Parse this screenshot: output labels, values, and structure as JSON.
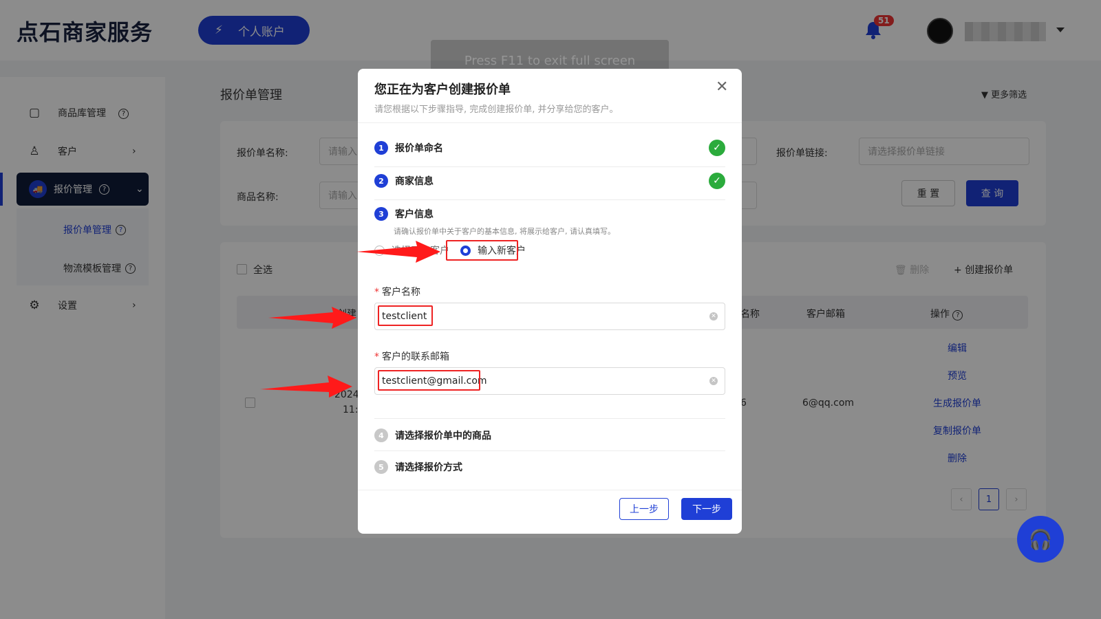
{
  "header": {
    "logo": "点石商家服务",
    "account_button": "个人账户",
    "notification_count": "51"
  },
  "sidebar": {
    "items": [
      {
        "label": "商品库管理",
        "icon": "box-icon"
      },
      {
        "label": "客户",
        "icon": "user-icon"
      },
      {
        "label": "报价管理",
        "icon": "truck-icon"
      },
      {
        "label": "设置",
        "icon": "gear-icon"
      }
    ],
    "sub_items": [
      {
        "label": "报价单管理"
      },
      {
        "label": "物流模板管理"
      }
    ]
  },
  "main": {
    "title": "报价单管理",
    "more_filters": "更多筛选",
    "filters": {
      "quote_name_label": "报价单名称:",
      "quote_name_placeholder": "请输入",
      "product_name_label": "商品名称:",
      "product_name_placeholder": "请输入",
      "quote_link_label": "报价单链接:",
      "quote_link_placeholder": "请选择报价单链接",
      "reset": "重 置",
      "query": "查 询"
    },
    "list": {
      "select_all": "全选",
      "delete": "删除",
      "create": "创建报价单",
      "columns": [
        "创建",
        "名称",
        "客户邮箱",
        "操作"
      ],
      "row": {
        "date": "2024",
        "time": "11:",
        "name_tail": "6",
        "email": "6@qq.com"
      },
      "actions": [
        "编辑",
        "预览",
        "生成报价单",
        "复制报价单",
        "删除"
      ],
      "page": "1"
    }
  },
  "toast": "Press  F11  to exit full screen",
  "modal": {
    "title": "您正在为客户创建报价单",
    "subtitle": "请您根据以下步骤指导, 完成创建报价单, 并分享给您的客户。",
    "steps": [
      {
        "num": "1",
        "label": "报价单命名"
      },
      {
        "num": "2",
        "label": "商家信息"
      },
      {
        "num": "3",
        "label": "客户信息"
      },
      {
        "num": "4",
        "label": "请选择报价单中的商品"
      },
      {
        "num": "5",
        "label": "请选择报价方式"
      }
    ],
    "step3_note": "请确认报价单中关于客户的基本信息, 将展示给客户, 请认真填写。",
    "radio_existing": "选择已有客户",
    "radio_new": "输入新客户",
    "customer_name_label": "客户名称",
    "customer_name_value": "testclient",
    "customer_email_label": "客户的联系邮箱",
    "customer_email_value": "testclient@gmail.com",
    "prev": "上一步",
    "next": "下一步"
  },
  "colors": {
    "primary": "#1f3fd6",
    "success": "#2bab3c",
    "annotation": "#e22222",
    "sidebar_active": "#0f1c3a"
  }
}
